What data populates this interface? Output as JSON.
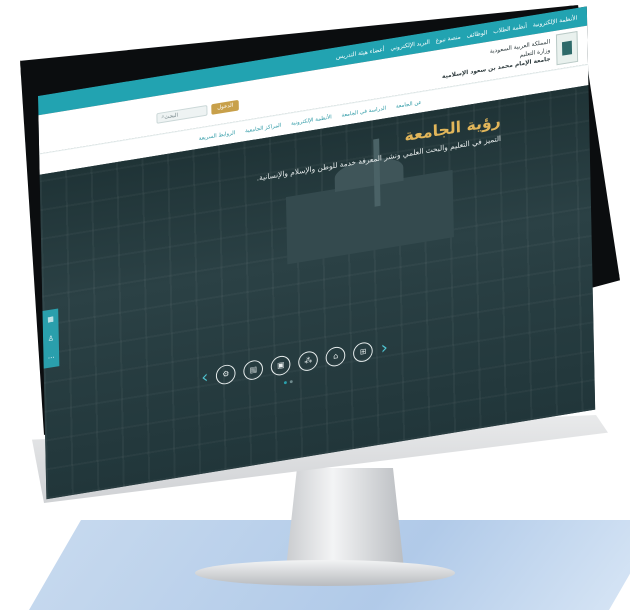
{
  "topbar": {
    "links": [
      "الأنظمة الإلكترونية",
      "أنظمة الطلاب",
      "الوظائف",
      "منصة نبوغ",
      "البريد الإلكتروني",
      "أعضاء هيئة التدريس"
    ]
  },
  "header": {
    "kingdom": "المملكة العربية السعودية",
    "ministry": "وزارة التعليم",
    "university": "جامعة الإمام محمد بن سعود الإسلامية",
    "login_label": "الدخول",
    "search_placeholder": "البحث"
  },
  "nav": {
    "items": [
      "عن الجامعة",
      "الدراسة في الجامعة",
      "الأنظمة الإلكترونية",
      "المراكز الجامعية",
      "الروابط السريعة"
    ]
  },
  "hero": {
    "title": "رؤية الجامعة",
    "subtitle": "التميز في التعليم والبحث العلمي ونشر المعرفة خدمة للوطن والإسلام والإنسانية."
  },
  "sidebar": {
    "icons": [
      "calendar-icon",
      "user-icon",
      "more-icon"
    ]
  },
  "carousel": {
    "icons": [
      "e-services-icon",
      "library-icon",
      "presentation-icon",
      "network-icon",
      "graduation-icon",
      "board-icon"
    ],
    "active_dot": 1,
    "dot_count": 2
  },
  "colors": {
    "primary": "#22a3b1",
    "gold": "#e2b65a",
    "hero_bg": "#24363a"
  }
}
